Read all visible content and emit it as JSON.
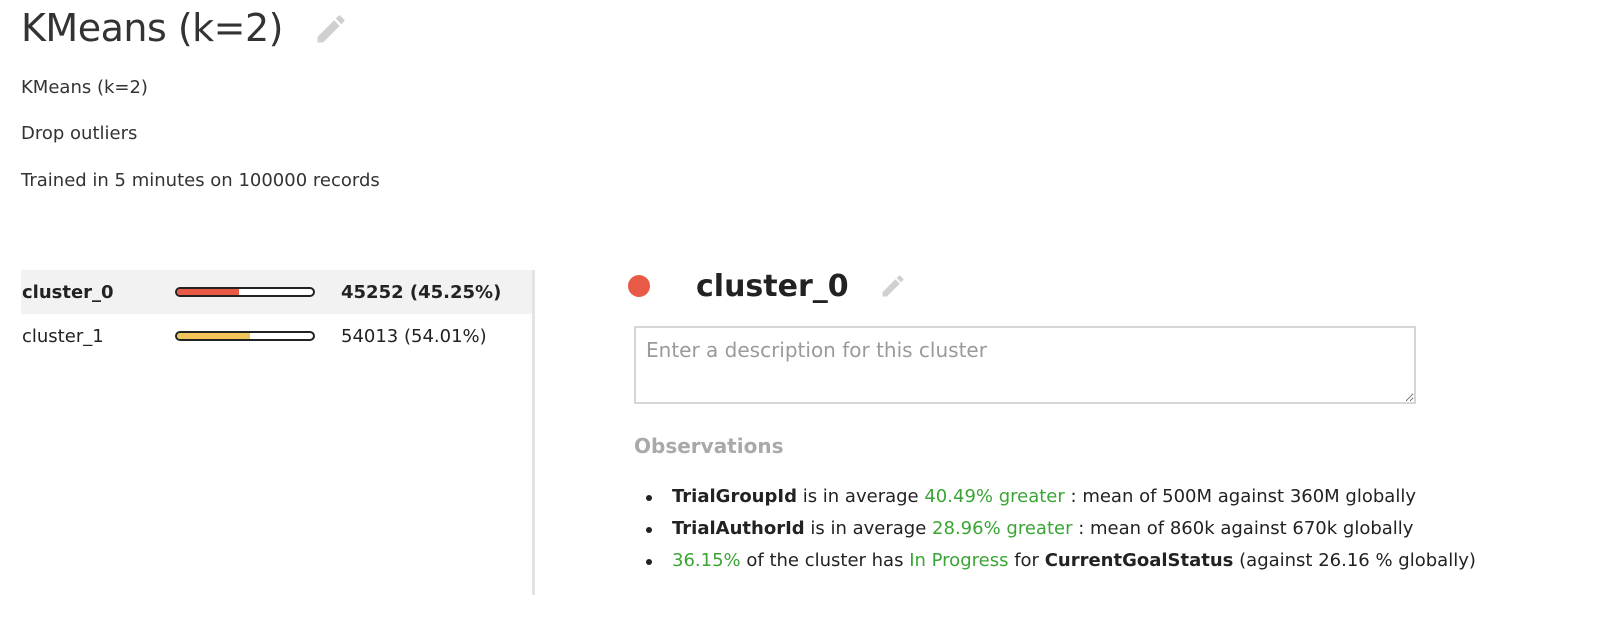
{
  "header": {
    "title": "KMeans (k=2)",
    "edit_icon": "pencil-icon",
    "subtitle": "KMeans (k=2)",
    "preprocessing": "Drop outliers",
    "training_info": "Trained in 5 minutes on 100000 records"
  },
  "clusters": [
    {
      "name": "cluster_0",
      "count_text": "45252 (45.25%)",
      "fraction": 0.4525,
      "color": "#e85a45",
      "selected": true
    },
    {
      "name": "cluster_1",
      "count_text": "54013 (54.01%)",
      "fraction": 0.5401,
      "color": "#f3c45a",
      "selected": false
    }
  ],
  "detail": {
    "name": "cluster_0",
    "dot_color": "#e85a45",
    "edit_icon": "pencil-icon",
    "description_placeholder": "Enter a description for this cluster",
    "description_value": "",
    "observations_title": "Observations",
    "observations": [
      {
        "feature": "TrialGroupId",
        "text1": "is in average",
        "highlight": "40.49% greater",
        "text2": ": mean of 500M against 360M globally"
      },
      {
        "feature": "TrialAuthorId",
        "text1": "is in average",
        "highlight": "28.96% greater",
        "text2": ": mean of 860k against 670k globally"
      },
      {
        "pct": "36.15%",
        "text1": "of the cluster has",
        "value": "In Progress",
        "text2": "for",
        "feature": "CurrentGoalStatus",
        "text3": "(against 26.16 % globally)"
      }
    ]
  },
  "colors": {
    "positive": "#3aa535"
  }
}
